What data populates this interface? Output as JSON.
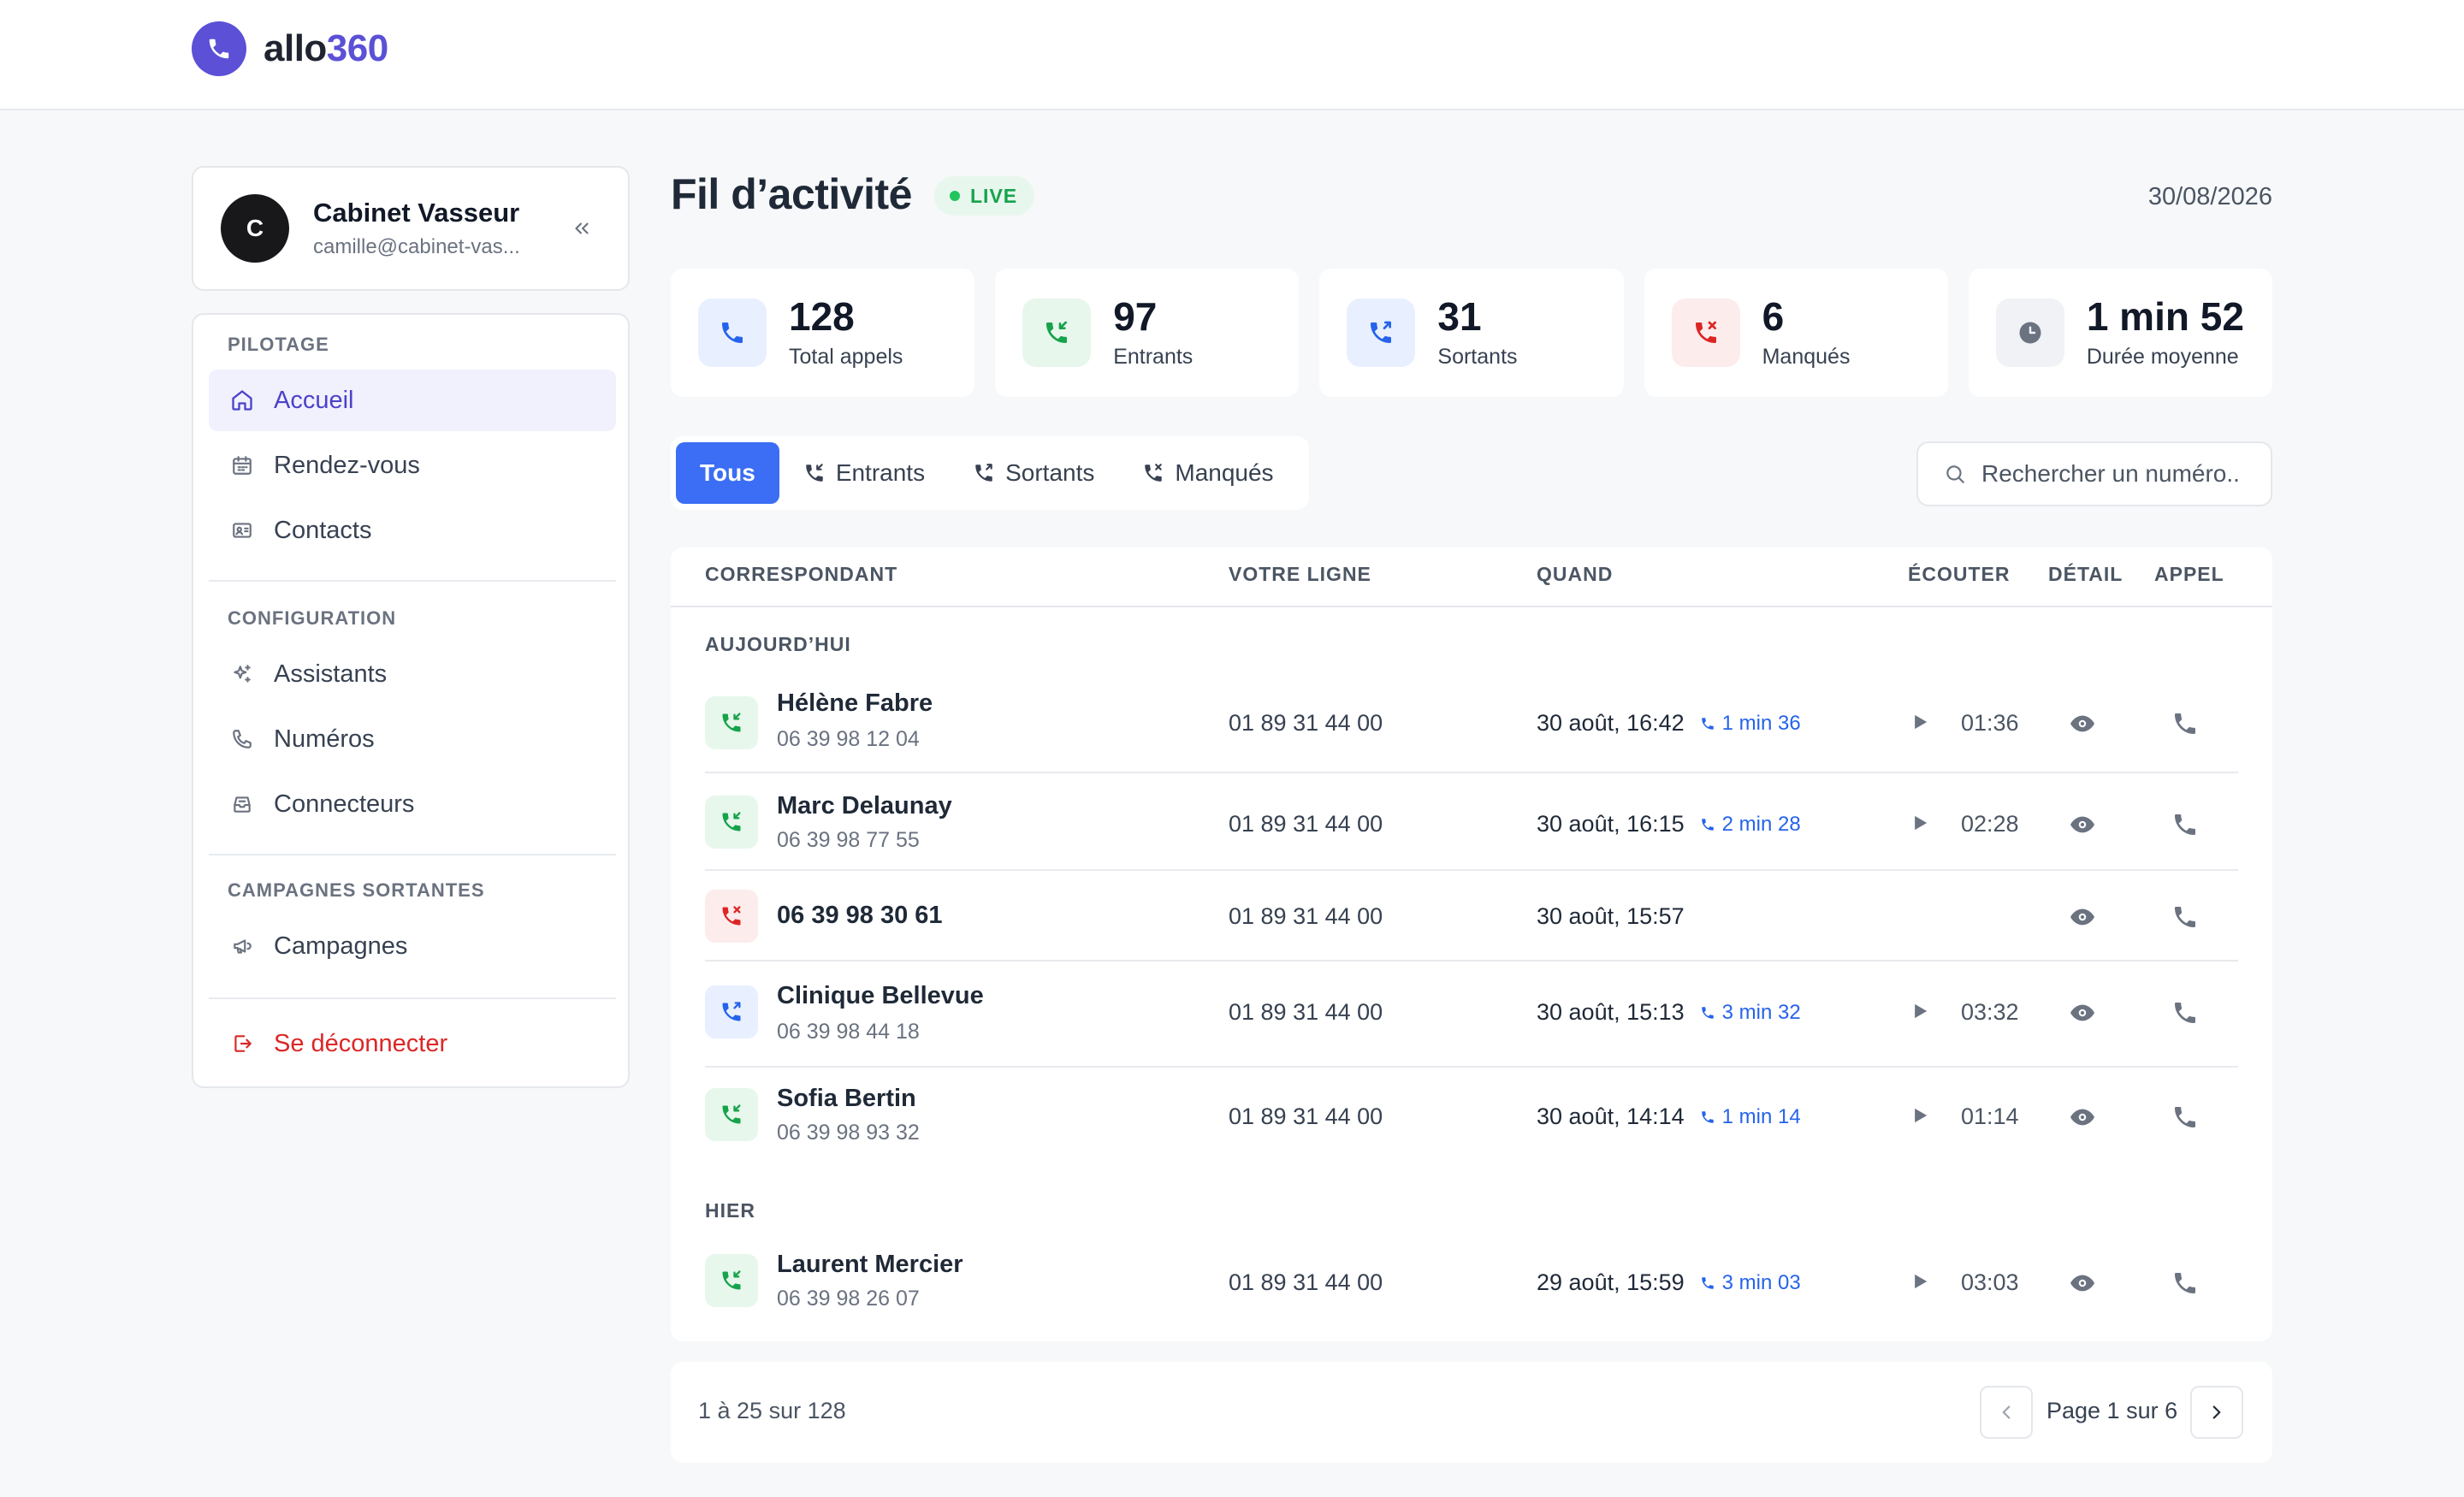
{
  "app": {
    "name_prefix": "allo",
    "name_suffix": "360"
  },
  "profile": {
    "initial": "C",
    "name": "Cabinet Vasseur",
    "email": "camille@cabinet-vas..."
  },
  "nav": {
    "pilotage_title": "PILOTAGE",
    "accueil": "Accueil",
    "rendezvous": "Rendez-vous",
    "contacts": "Contacts",
    "configuration_title": "CONFIGURATION",
    "assistants": "Assistants",
    "numeros": "Numéros",
    "connecteurs": "Connecteurs",
    "campagnes_title": "CAMPAGNES SORTANTES",
    "campagnes": "Campagnes",
    "logout": "Se déconnecter"
  },
  "page": {
    "title": "Fil d’activité",
    "live": "LIVE",
    "date": "30/08/2026"
  },
  "stats": [
    {
      "value": "128",
      "label": "Total appels"
    },
    {
      "value": "97",
      "label": "Entrants"
    },
    {
      "value": "31",
      "label": "Sortants"
    },
    {
      "value": "6",
      "label": "Manqués"
    },
    {
      "value": "1 min 52",
      "label": "Durée moyenne"
    }
  ],
  "filters": {
    "all": "Tous",
    "incoming": "Entrants",
    "outgoing": "Sortants",
    "missed": "Manqués"
  },
  "search": {
    "placeholder": "Rechercher un numéro..",
    "value": ""
  },
  "table": {
    "headers": {
      "correspondant": "CORRESPONDANT",
      "ligne": "VOTRE LIGNE",
      "quand": "QUAND",
      "ecouter": "ÉCOUTER",
      "detail": "DÉTAIL",
      "appel": "APPEL"
    },
    "group_today": "AUJOURD’HUI",
    "group_yesterday": "HIER",
    "rows": [
      {
        "direction": "incoming",
        "name": "Hélène Fabre",
        "number": "06 39 98 12 04",
        "line": "01 89 31 44 00",
        "when": "30 août, 16:42",
        "duration": "1 min 36",
        "audio": "01:36"
      },
      {
        "direction": "incoming",
        "name": "Marc Delaunay",
        "number": "06 39 98 77 55",
        "line": "01 89 31 44 00",
        "when": "30 août, 16:15",
        "duration": "2 min 28",
        "audio": "02:28"
      },
      {
        "direction": "missed",
        "name": "06 39 98 30 61",
        "number": "",
        "line": "01 89 31 44 00",
        "when": "30 août, 15:57",
        "duration": "",
        "audio": ""
      },
      {
        "direction": "outgoing",
        "name": "Clinique Bellevue",
        "number": "06 39 98 44 18",
        "line": "01 89 31 44 00",
        "when": "30 août, 15:13",
        "duration": "3 min 32",
        "audio": "03:32"
      },
      {
        "direction": "incoming",
        "name": "Sofia Bertin",
        "number": "06 39 98 93 32",
        "line": "01 89 31 44 00",
        "when": "30 août, 14:14",
        "duration": "1 min 14",
        "audio": "01:14"
      },
      {
        "direction": "incoming",
        "name": "Laurent Mercier",
        "number": "06 39 98 26 07",
        "line": "01 89 31 44 00",
        "when": "29 août, 15:59",
        "duration": "3 min 03",
        "audio": "03:03"
      }
    ]
  },
  "pagination": {
    "count": "1 à 25 sur 128",
    "page": "Page 1 sur 6"
  },
  "colors": {
    "brand": "#5b50d6",
    "primary": "#3b6ef5",
    "incoming": "#16a34a",
    "outgoing": "#2563eb",
    "missed": "#dc2626"
  }
}
